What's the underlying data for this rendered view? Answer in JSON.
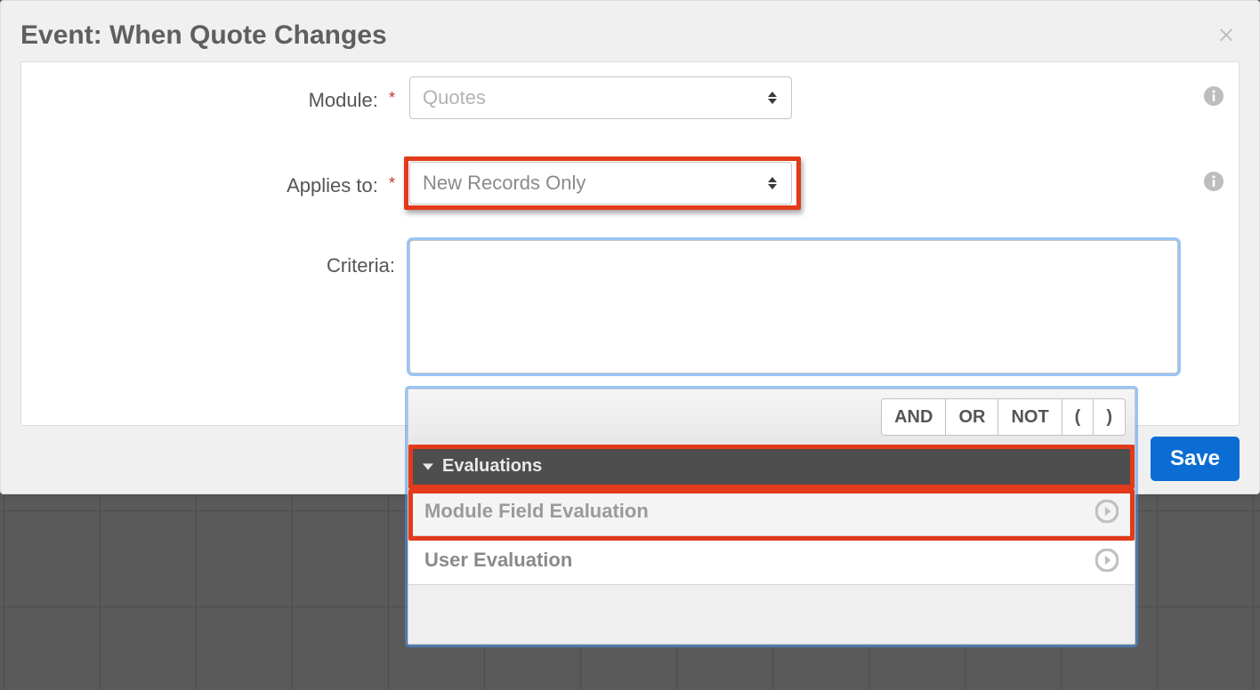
{
  "title": "Event: When Quote Changes",
  "labels": {
    "module": "Module:",
    "applies": "Applies to:",
    "criteria": "Criteria:"
  },
  "selects": {
    "module": "Quotes",
    "applies": "New Records Only"
  },
  "save_label": "Save",
  "tokens": {
    "and": "AND",
    "or": "OR",
    "not": "NOT",
    "lparen": "(",
    "rparen": ")"
  },
  "section_header": "Evaluations",
  "rows": {
    "module_field": "Module Field Evaluation",
    "user": "User Evaluation"
  }
}
